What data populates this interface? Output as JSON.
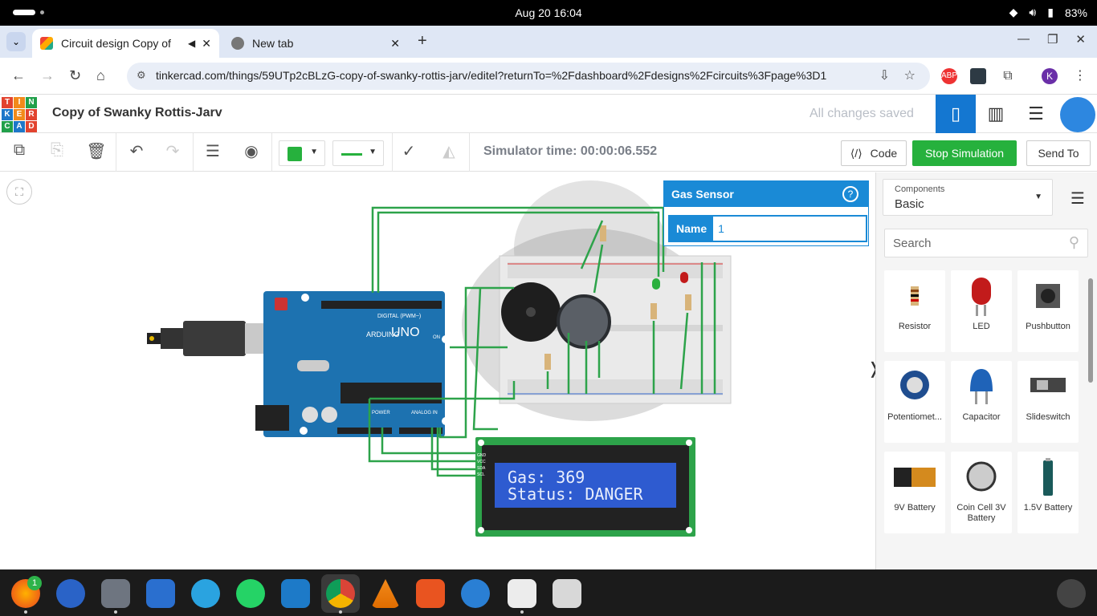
{
  "system": {
    "date_time": "Aug 20  16:04",
    "battery": "83%"
  },
  "browser": {
    "tabs": [
      {
        "title": "Circuit design Copy of",
        "active": true
      },
      {
        "title": "New tab",
        "active": false
      }
    ],
    "url": "tinkercad.com/things/59UTp2cBLzG-copy-of-swanky-rottis-jarv/editel?returnTo=%2Fdashboard%2Fdesigns%2Fcircuits%3Fpage%3D1",
    "profile_initial": "K",
    "abp_label": "ABP"
  },
  "app": {
    "logo_letters": [
      "TIN",
      "KER",
      "CAD"
    ],
    "title": "Copy of Swanky Rottis-Jarv",
    "save_status": "All changes saved"
  },
  "toolbar": {
    "sim_time": "Simulator time: 00:00:06.552",
    "code_label": "Code",
    "stop_label": "Stop Simulation",
    "send_label": "Send To",
    "wire_color": "#26b13d"
  },
  "inspector": {
    "title": "Gas Sensor",
    "name_label": "Name",
    "name_value": "1"
  },
  "lcd": {
    "line1": "Gas: 369",
    "line2": "Status: DANGER"
  },
  "arduino": {
    "brand": "ARDUINO",
    "model": "UNO",
    "digital_label": "DIGITAL (PWM~)",
    "analog_label": "ANALOG IN",
    "power_label": "POWER",
    "on_label": "ON"
  },
  "lcd_pins": [
    "GND",
    "VCC",
    "SDA",
    "SCL"
  ],
  "panel": {
    "components_label": "Components",
    "components_value": "Basic",
    "search_placeholder": "Search",
    "items": [
      {
        "name": "Resistor",
        "icon": "resistor-icon"
      },
      {
        "name": "LED",
        "icon": "led-icon"
      },
      {
        "name": "Pushbutton",
        "icon": "pushbutton-icon"
      },
      {
        "name": "Potentiomet...",
        "icon": "potentiometer-icon"
      },
      {
        "name": "Capacitor",
        "icon": "capacitor-icon"
      },
      {
        "name": "Slideswitch",
        "icon": "slideswitch-icon"
      },
      {
        "name": "9V Battery",
        "icon": "battery-9v-icon"
      },
      {
        "name": "Coin Cell 3V Battery",
        "icon": "coin-cell-icon"
      },
      {
        "name": "1.5V Battery",
        "icon": "battery-aa-icon"
      }
    ]
  },
  "taskbar": {
    "firefox_badge": "1"
  }
}
